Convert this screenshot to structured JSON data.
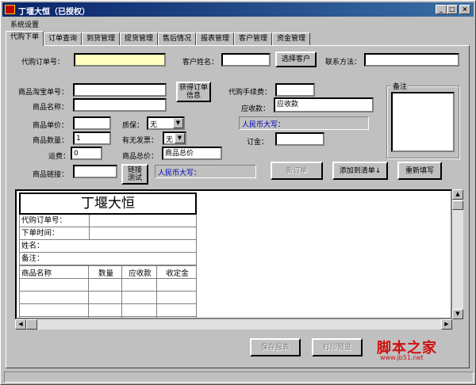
{
  "window": {
    "title": "丁堰大恒（已授权）",
    "controls": [
      "_",
      "□",
      "×"
    ]
  },
  "menu": {
    "system_settings": "系统设置"
  },
  "tabs": [
    {
      "label": "代购下单",
      "active": true
    },
    {
      "label": "订单查询"
    },
    {
      "label": "到货管理"
    },
    {
      "label": "提货管理"
    },
    {
      "label": "售后情况"
    },
    {
      "label": "报表管理"
    },
    {
      "label": "客户管理"
    },
    {
      "label": "资金管理"
    }
  ],
  "form": {
    "order_no_label": "代购订单号：",
    "order_no_value": "",
    "customer_name_label": "客户姓名：",
    "customer_name_value": "",
    "select_customer_button": "选择客户",
    "contact_label": "联系方法：",
    "contact_value": "",
    "taobao_no_label": "商品淘宝单号：",
    "taobao_no_value": "",
    "fetch_order_button": "获得订单信息",
    "product_name_label": "商品名称：",
    "product_name_value": "",
    "unit_price_label": "商品单价：",
    "unit_price_value": "",
    "warranty_label": "质保：",
    "warranty_value": "无",
    "quantity_label": "商品数量：",
    "quantity_value": "1",
    "invoice_label": "有无发票：",
    "invoice_value": "无",
    "shipping_label": "运费：",
    "shipping_value": "0",
    "total_price_label": "商品总价：",
    "total_price_value": "商品总价",
    "link_label": "商品链接：",
    "link_value": "",
    "link_test_button": "链接测试",
    "rmb_upper_left": "人民币大写：",
    "service_fee_label": "代购手续费：",
    "service_fee_value": "",
    "receivable_label": "应收款：",
    "receivable_value": "应收款",
    "rmb_upper_right": "人民币大写：",
    "deposit_label": "订金：",
    "deposit_value": "",
    "remarks_group": "备注",
    "new_order_button": "新订单",
    "add_to_list_button": "添加到清单↓",
    "refill_button": "重新填写"
  },
  "receipt": {
    "title": "丁堰大恒",
    "rows": [
      "代购订单号：",
      "下单时间：",
      "姓名：",
      "备注："
    ],
    "columns": [
      "商品名称",
      "数量",
      "应收款",
      "收定金"
    ]
  },
  "footer": {
    "save_report_button": "保存报表",
    "print_preview_button": "打印预览"
  },
  "watermark": {
    "main": "脚本之家",
    "sub": "www.jb51.net"
  }
}
